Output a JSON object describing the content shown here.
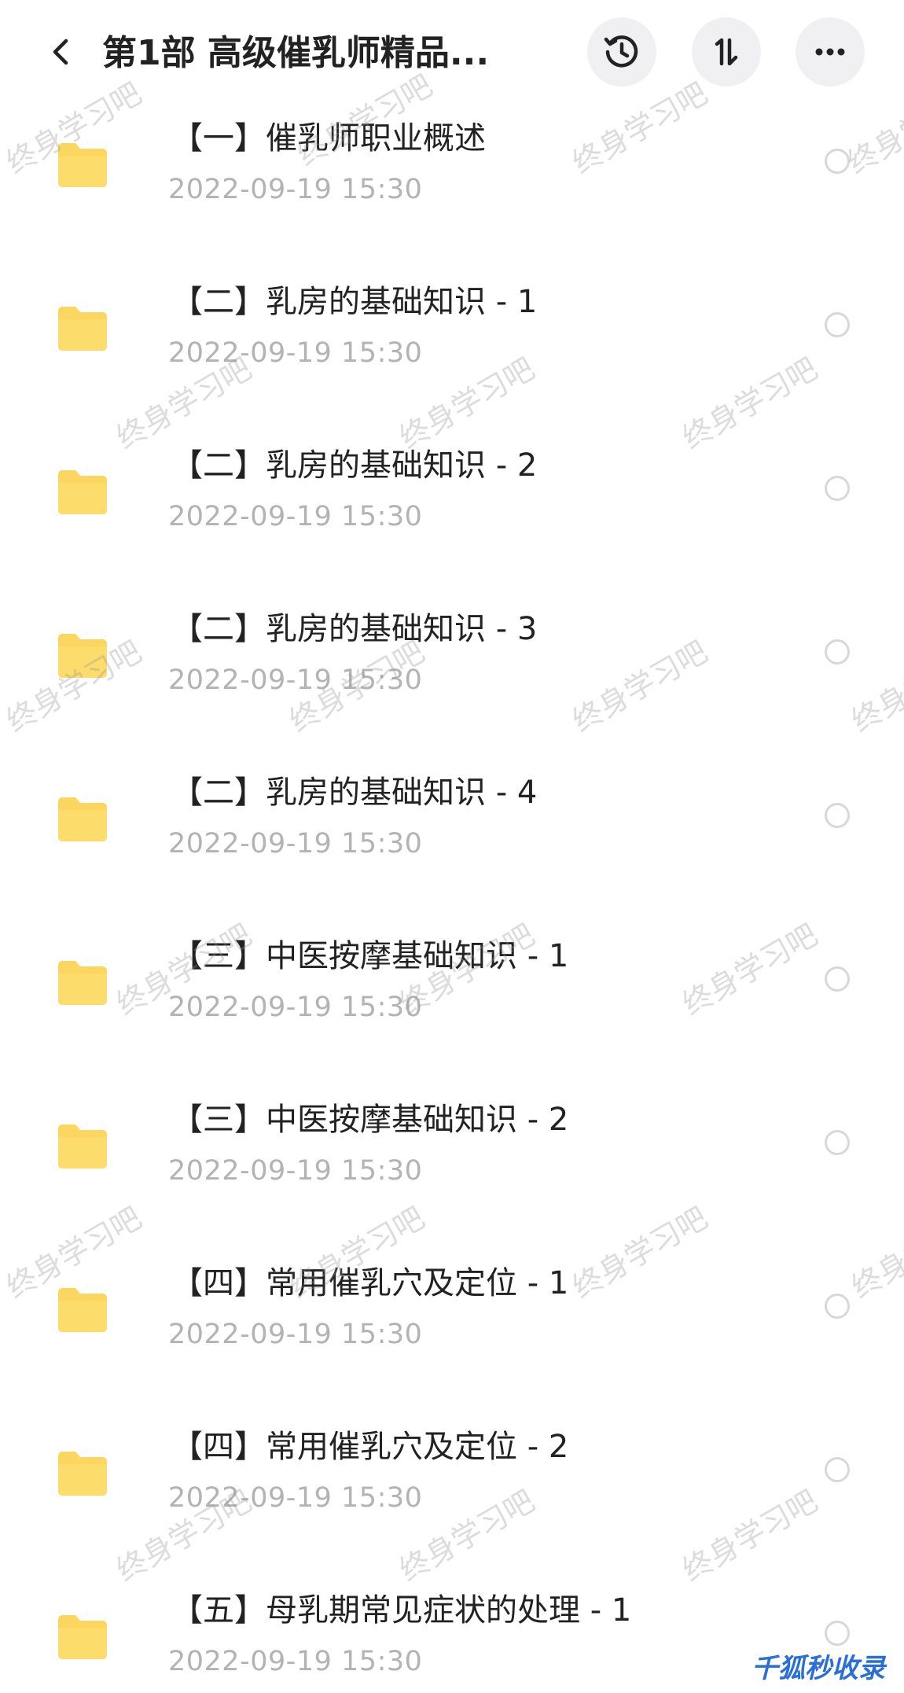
{
  "header": {
    "title": "第1部 高级催乳师精品...",
    "sort_label": "1↓"
  },
  "colors": {
    "folder": "#fbd660",
    "title_text": "#222222",
    "date_text": "#b3b3b3",
    "button_bg": "#f0f0f2"
  },
  "items": [
    {
      "title": "【一】催乳师职业概述",
      "date": "2022-09-19  15:30"
    },
    {
      "title": "【二】乳房的基础知识 - 1",
      "date": "2022-09-19  15:30"
    },
    {
      "title": "【二】乳房的基础知识 - 2",
      "date": "2022-09-19  15:30"
    },
    {
      "title": "【二】乳房的基础知识 - 3",
      "date": "2022-09-19  15:30"
    },
    {
      "title": "【二】乳房的基础知识 - 4",
      "date": "2022-09-19  15:30"
    },
    {
      "title": "【三】中医按摩基础知识 - 1",
      "date": "2022-09-19  15:30"
    },
    {
      "title": "【三】中医按摩基础知识 - 2",
      "date": "2022-09-19  15:30"
    },
    {
      "title": "【四】常用催乳穴及定位 - 1",
      "date": "2022-09-19  15:30"
    },
    {
      "title": "【四】常用催乳穴及定位 - 2",
      "date": "2022-09-19  15:30"
    },
    {
      "title": "【五】母乳期常见症状的处理 - 1",
      "date": "2022-09-19  15:30"
    }
  ],
  "watermark": "终身学习吧",
  "corner_logo": "千狐秒收录"
}
